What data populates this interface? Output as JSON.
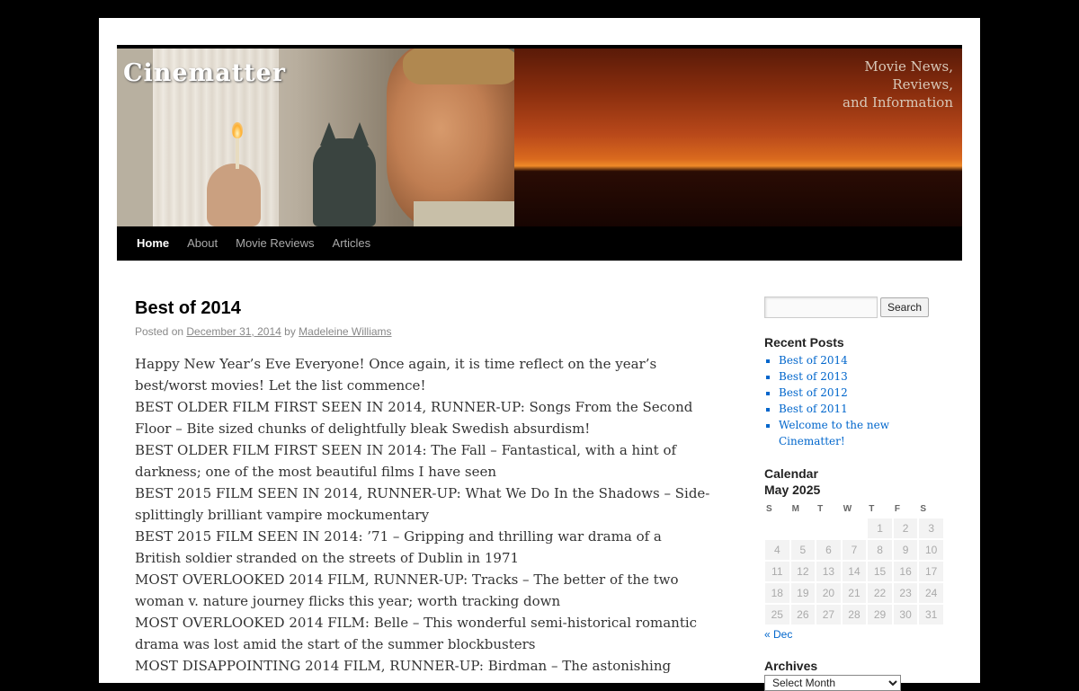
{
  "site": {
    "title": "Cinematter",
    "tagline_lines": [
      "Movie News,",
      "Reviews,",
      "and Information"
    ]
  },
  "nav": {
    "items": [
      {
        "label": "Home",
        "active": true
      },
      {
        "label": "About",
        "active": false
      },
      {
        "label": "Movie Reviews",
        "active": false
      },
      {
        "label": "Articles",
        "active": false
      }
    ]
  },
  "post": {
    "title": "Best of 2014",
    "meta": {
      "posted_on": "Posted on",
      "date": "December 31, 2014",
      "by": "by",
      "author": "Madeleine Williams"
    },
    "paragraphs": [
      "Happy New Year’s Eve Everyone! Once again, it is time reflect on the year’s best/worst movies! Let the list commence!",
      "BEST OLDER FILM FIRST SEEN IN 2014, RUNNER-UP: Songs From the Second Floor – Bite sized chunks of delightfully bleak Swedish absurdism!",
      "BEST OLDER FILM FIRST SEEN IN 2014: The Fall – Fantastical, with a hint of darkness; one of the most beautiful films I have seen",
      "BEST 2015 FILM SEEN IN 2014, RUNNER-UP: What We Do In the Shadows – Side-splittingly brilliant vampire mockumentary",
      "BEST 2015 FILM SEEN IN 2014: ’71 – Gripping and thrilling war drama of a British soldier stranded on the streets of Dublin in 1971",
      "MOST OVERLOOKED 2014 FILM, RUNNER-UP: Tracks – The better of the two woman v. nature journey flicks this year; worth tracking down",
      "MOST OVERLOOKED 2014 FILM: Belle – This wonderful semi-historical romantic drama was lost amid the start of the summer blockbusters",
      "MOST DISAPPOINTING 2014 FILM, RUNNER-UP: Birdman – The astonishing"
    ]
  },
  "sidebar": {
    "search": {
      "placeholder": "",
      "button_label": "Search"
    },
    "recent_posts": {
      "title": "Recent Posts",
      "items": [
        "Best of 2014",
        "Best of 2013",
        "Best of 2012",
        "Best of 2011",
        "Welcome to the new Cinematter!"
      ]
    },
    "calendar": {
      "title": "Calendar",
      "caption": "May 2025",
      "weekdays": [
        "S",
        "M",
        "T",
        "W",
        "T",
        "F",
        "S"
      ],
      "weeks": [
        [
          "",
          "",
          "",
          "",
          "1",
          "2",
          "3"
        ],
        [
          "4",
          "5",
          "6",
          "7",
          "8",
          "9",
          "10"
        ],
        [
          "11",
          "12",
          "13",
          "14",
          "15",
          "16",
          "17"
        ],
        [
          "18",
          "19",
          "20",
          "21",
          "22",
          "23",
          "24"
        ],
        [
          "25",
          "26",
          "27",
          "28",
          "29",
          "30",
          "31"
        ]
      ],
      "prev_link": "« Dec"
    },
    "archives": {
      "title": "Archives",
      "select_value": "Select Month"
    }
  }
}
